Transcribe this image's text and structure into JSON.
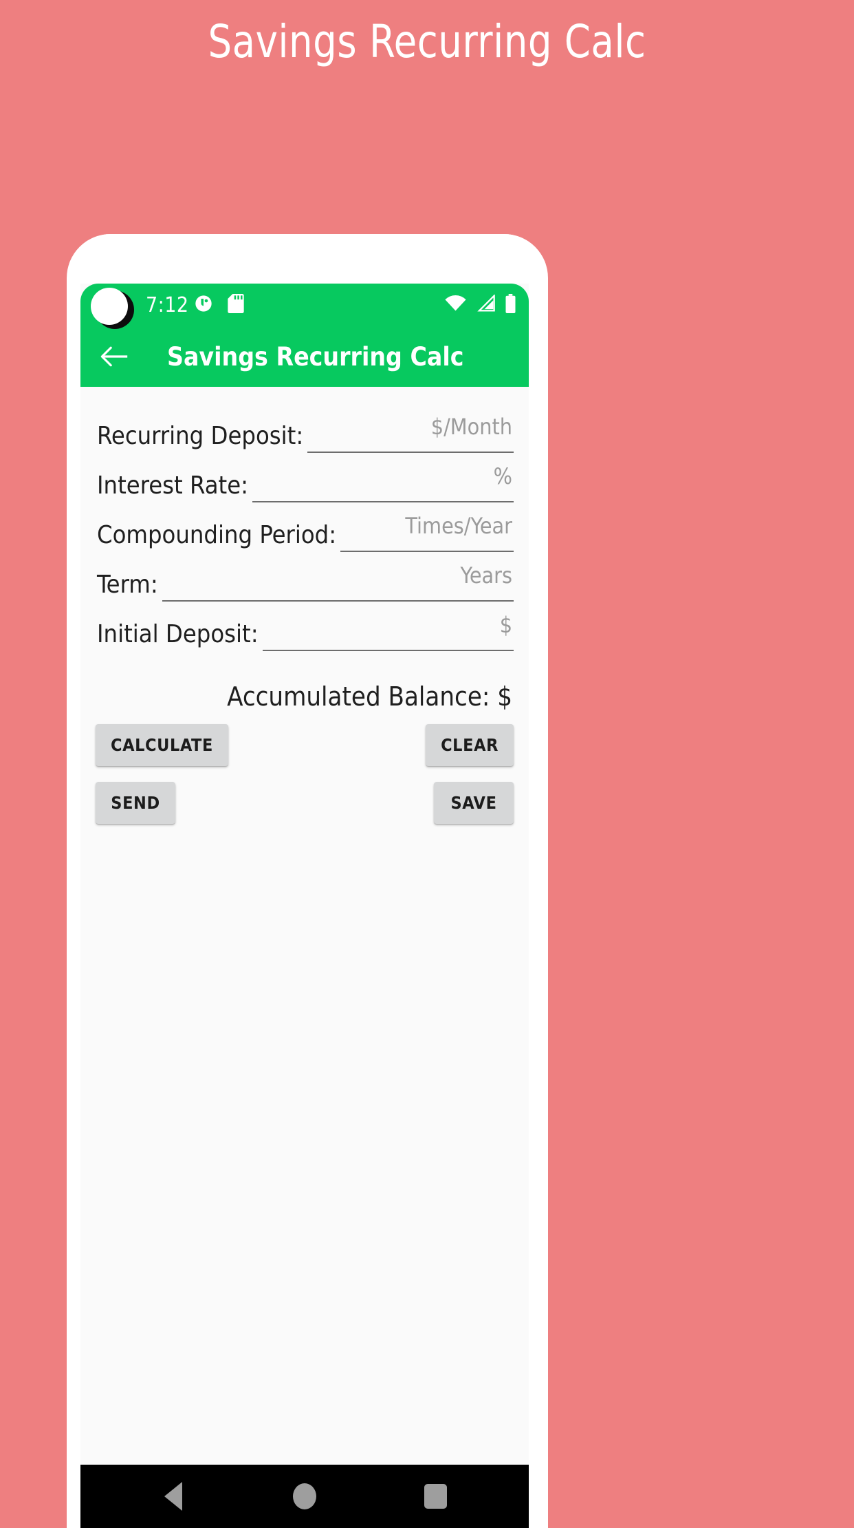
{
  "page": {
    "title": "Savings Recurring Calc",
    "background_color": "#ee7f80"
  },
  "device": {
    "statusbar": {
      "time": "7:12",
      "accent_color": "#07c95f",
      "left_icons": [
        "app-notification-icon",
        "sd-card-icon"
      ],
      "right_icons": [
        "wifi-icon",
        "cellular-signal-icon",
        "battery-icon"
      ]
    },
    "appbar": {
      "back_label": "←",
      "title": "Savings Recurring Calc"
    },
    "navbar": {
      "back_label": "back-triangle",
      "home_label": "home-circle",
      "recents_label": "recents-square"
    }
  },
  "form": {
    "fields": [
      {
        "label": "Recurring Deposit:",
        "placeholder": "$/Month",
        "value": ""
      },
      {
        "label": "Interest Rate:",
        "placeholder": "%",
        "value": ""
      },
      {
        "label": "Compounding Period:",
        "placeholder": "Times/Year",
        "value": ""
      },
      {
        "label": "Term:",
        "placeholder": "Years",
        "value": ""
      },
      {
        "label": "Initial Deposit:",
        "placeholder": "$",
        "value": ""
      }
    ],
    "result": "Accumulated Balance: $"
  },
  "buttons": {
    "calculate": "CALCULATE",
    "clear": "CLEAR",
    "send": "SEND",
    "save": "SAVE"
  }
}
